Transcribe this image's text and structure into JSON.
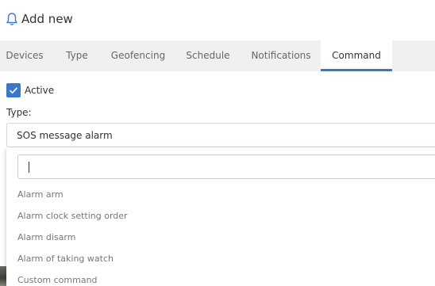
{
  "header": {
    "title": "Add new",
    "icon": "bell-icon"
  },
  "tabs": [
    {
      "label": "Devices",
      "active": false
    },
    {
      "label": "Type",
      "active": false
    },
    {
      "label": "Geofencing",
      "active": false
    },
    {
      "label": "Schedule",
      "active": false
    },
    {
      "label": "Notifications",
      "active": false
    },
    {
      "label": "Command",
      "active": true
    }
  ],
  "form": {
    "active_label": "Active",
    "active_checked": true,
    "type_label": "Type:",
    "type_value": "SOS message alarm"
  },
  "dropdown": {
    "search_value": "",
    "options": [
      "Alarm arm",
      "Alarm clock setting order",
      "Alarm disarm",
      "Alarm of taking watch",
      "Custom command"
    ]
  },
  "colors": {
    "accent": "#3c78c8",
    "tab_bar": "#f0f0f0",
    "option_text": "#777777"
  }
}
